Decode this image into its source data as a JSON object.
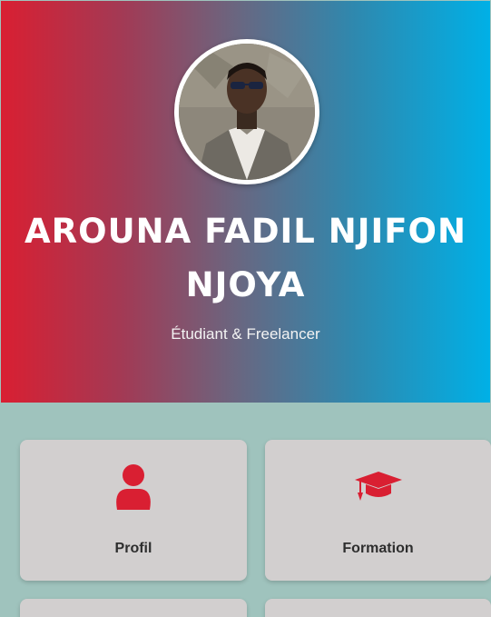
{
  "header": {
    "name_line1": "AROUNA FADIL NJIFON",
    "name_line2": "NJOYA",
    "subtitle": "Étudiant & Freelancer",
    "avatar_icon": "profile-photo",
    "gradient_start": "#d91f32",
    "gradient_end": "#00b0e6"
  },
  "cards": [
    {
      "label": "Profil",
      "icon": "user-icon",
      "color": "#d91f32"
    },
    {
      "label": "Formation",
      "icon": "graduation-cap-icon",
      "color": "#d91f32"
    }
  ]
}
